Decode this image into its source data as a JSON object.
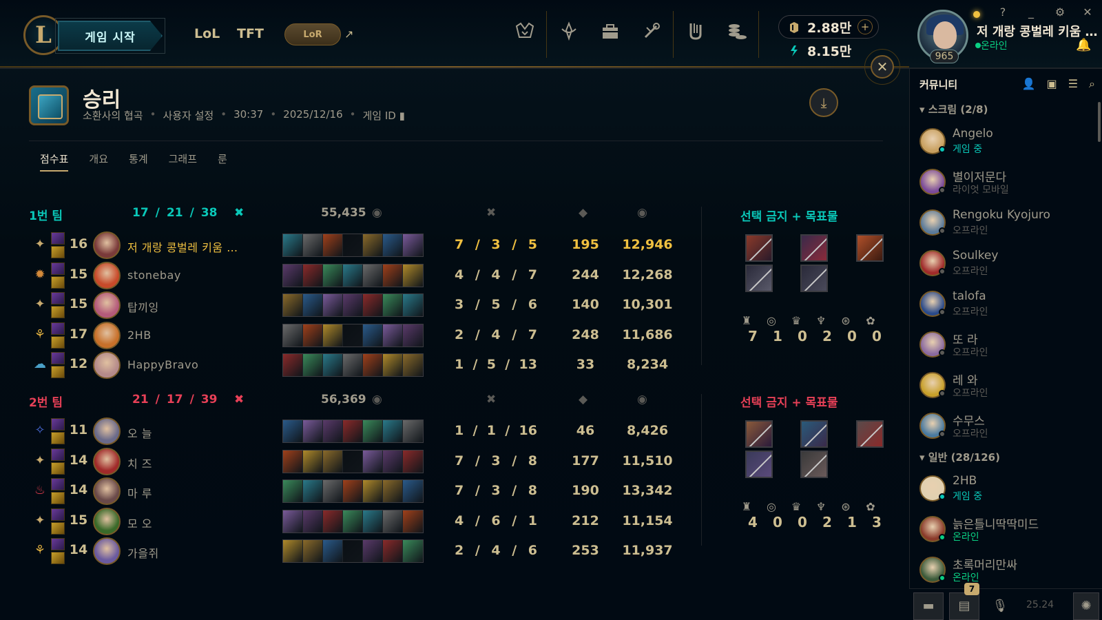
{
  "header": {
    "play_label": "게임 시작",
    "nav": [
      "LoL",
      "TFT"
    ],
    "lor_label": "LoR",
    "rp": "2.88만",
    "be": "8.15만",
    "colors": {
      "gold": "#c8aa6e",
      "teal": "#0ac8b9",
      "blue": "#0397ab",
      "red": "#e84057"
    }
  },
  "profile": {
    "name": "저 개랑 콩벌레 키움 …",
    "status": "온라인",
    "level": "965"
  },
  "match": {
    "result": "승리",
    "mode": "소환사의 협곡",
    "type": "사용자 설정",
    "duration": "30:37",
    "date": "2025/12/16",
    "game_id_label": "게임 ID"
  },
  "tabs": [
    "점수표",
    "개요",
    "통계",
    "그래프",
    "룬"
  ],
  "team1": {
    "name": "1번 팀",
    "k": "17",
    "d": "21",
    "a": "38",
    "gold": "55,435",
    "bans_label": "선택 금지 + 목표물",
    "objectives": [
      "7",
      "1",
      "0",
      "2",
      "0",
      "0"
    ],
    "players": [
      {
        "level": "16",
        "name": "저 개랑 콩벌레 키움 …",
        "k": "7",
        "d": "3",
        "a": "5",
        "cs": "195",
        "gold": "12,946",
        "me": true
      },
      {
        "level": "15",
        "name": "stonebay",
        "k": "4",
        "d": "4",
        "a": "7",
        "cs": "244",
        "gold": "12,268"
      },
      {
        "level": "15",
        "name": "탑끼잉",
        "k": "3",
        "d": "5",
        "a": "6",
        "cs": "140",
        "gold": "10,301"
      },
      {
        "level": "17",
        "name": "2HB",
        "k": "2",
        "d": "4",
        "a": "7",
        "cs": "248",
        "gold": "11,686"
      },
      {
        "level": "12",
        "name": "HappyBravo",
        "k": "1",
        "d": "5",
        "a": "13",
        "cs": "33",
        "gold": "8,234"
      }
    ]
  },
  "team2": {
    "name": "2번 팀",
    "k": "21",
    "d": "17",
    "a": "39",
    "gold": "56,369",
    "bans_label": "선택 금지 + 목표물",
    "objectives": [
      "4",
      "0",
      "0",
      "2",
      "1",
      "3"
    ],
    "players": [
      {
        "level": "11",
        "name": "오 늘",
        "k": "1",
        "d": "1",
        "a": "16",
        "cs": "46",
        "gold": "8,426"
      },
      {
        "level": "14",
        "name": "치 즈",
        "k": "7",
        "d": "3",
        "a": "8",
        "cs": "177",
        "gold": "11,510"
      },
      {
        "level": "14",
        "name": "마 루",
        "k": "7",
        "d": "3",
        "a": "8",
        "cs": "190",
        "gold": "13,342"
      },
      {
        "level": "15",
        "name": "모 오",
        "k": "4",
        "d": "6",
        "a": "1",
        "cs": "212",
        "gold": "11,154"
      },
      {
        "level": "14",
        "name": "가을쥐",
        "k": "2",
        "d": "4",
        "a": "6",
        "cs": "253",
        "gold": "11,937"
      }
    ]
  },
  "social": {
    "title": "커뮤니티",
    "group1": "스크림 (2/8)",
    "group2": "일반 (28/126)",
    "friends": [
      {
        "name": "Angelo",
        "status": "게임 중",
        "state": "ingame"
      },
      {
        "name": "별이저문다",
        "status": "라이엇 모바일",
        "state": "mobile"
      },
      {
        "name": "Rengoku Kyojuro",
        "status": "오프라인",
        "state": "offline"
      },
      {
        "name": "Soulkey",
        "status": "오프라인",
        "state": "offline"
      },
      {
        "name": "talofa",
        "status": "오프라인",
        "state": "offline"
      },
      {
        "name": "또 라",
        "status": "오프라인",
        "state": "offline"
      },
      {
        "name": "레 와",
        "status": "오프라인",
        "state": "offline"
      },
      {
        "name": "수무스",
        "status": "오프라인",
        "state": "offline"
      },
      {
        "name": "2HB",
        "status": "게임 중",
        "state": "ingame"
      },
      {
        "name": "늙은틀니딱딱미드",
        "status": "온라인",
        "state": "online"
      },
      {
        "name": "초록머리만싸",
        "status": "온라인",
        "state": "online"
      }
    ],
    "notif_count": "7",
    "version": "25.24"
  }
}
